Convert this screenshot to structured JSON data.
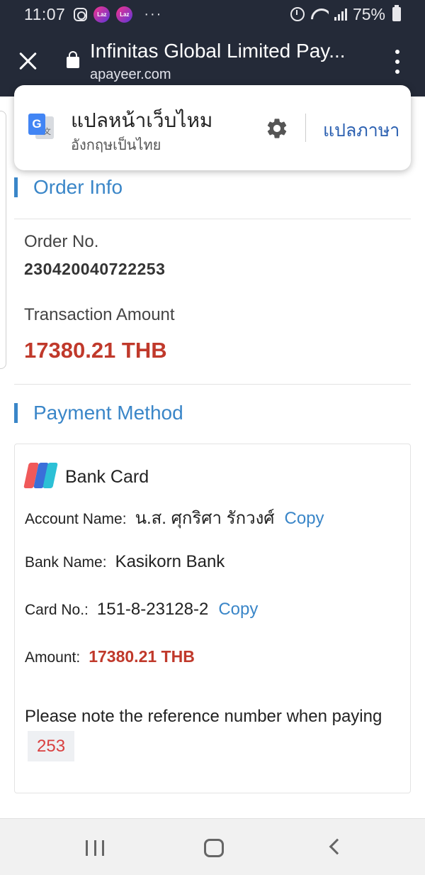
{
  "status_bar": {
    "time": "11:07",
    "more": "···",
    "battery": "75%"
  },
  "browser": {
    "title": "Infinitas Global Limited Pay...",
    "url": "apayeer.com"
  },
  "translate_popup": {
    "title": "แปลหน้าเว็บไหม",
    "subtitle": "อังกฤษเป็นไทย",
    "translate_button": "แปลภาษา"
  },
  "order_info": {
    "section_title": "Order Info",
    "order_no_label": "Order No.",
    "order_no": "230420040722253",
    "amount_label": "Transaction Amount",
    "amount": "17380.21 THB"
  },
  "payment": {
    "section_title": "Payment Method",
    "method": "Bank Card",
    "account_name_label": "Account Name:",
    "account_name": "น.ส. ศุกริศา รักวงศ์",
    "bank_name_label": "Bank Name:",
    "bank_name": "Kasikorn Bank",
    "card_no_label": "Card No.:",
    "card_no": "151-8-23128-2",
    "amount_label": "Amount:",
    "amount": "17380.21 THB",
    "copy_label": "Copy",
    "note": "Please note the reference number when paying",
    "reference": "253"
  },
  "colors": {
    "accent": "#3a86c8",
    "amount_red": "#c0392b",
    "toolbar": "#242a38"
  },
  "icons": [
    "instagram-icon",
    "lazada-icon",
    "alarm-icon",
    "wifi-icon",
    "signal-icon",
    "battery-icon",
    "close-icon",
    "lock-icon",
    "more-vert-icon",
    "google-translate-icon",
    "gear-icon",
    "bank-card-icon",
    "recent-apps-icon",
    "home-icon",
    "back-icon"
  ]
}
